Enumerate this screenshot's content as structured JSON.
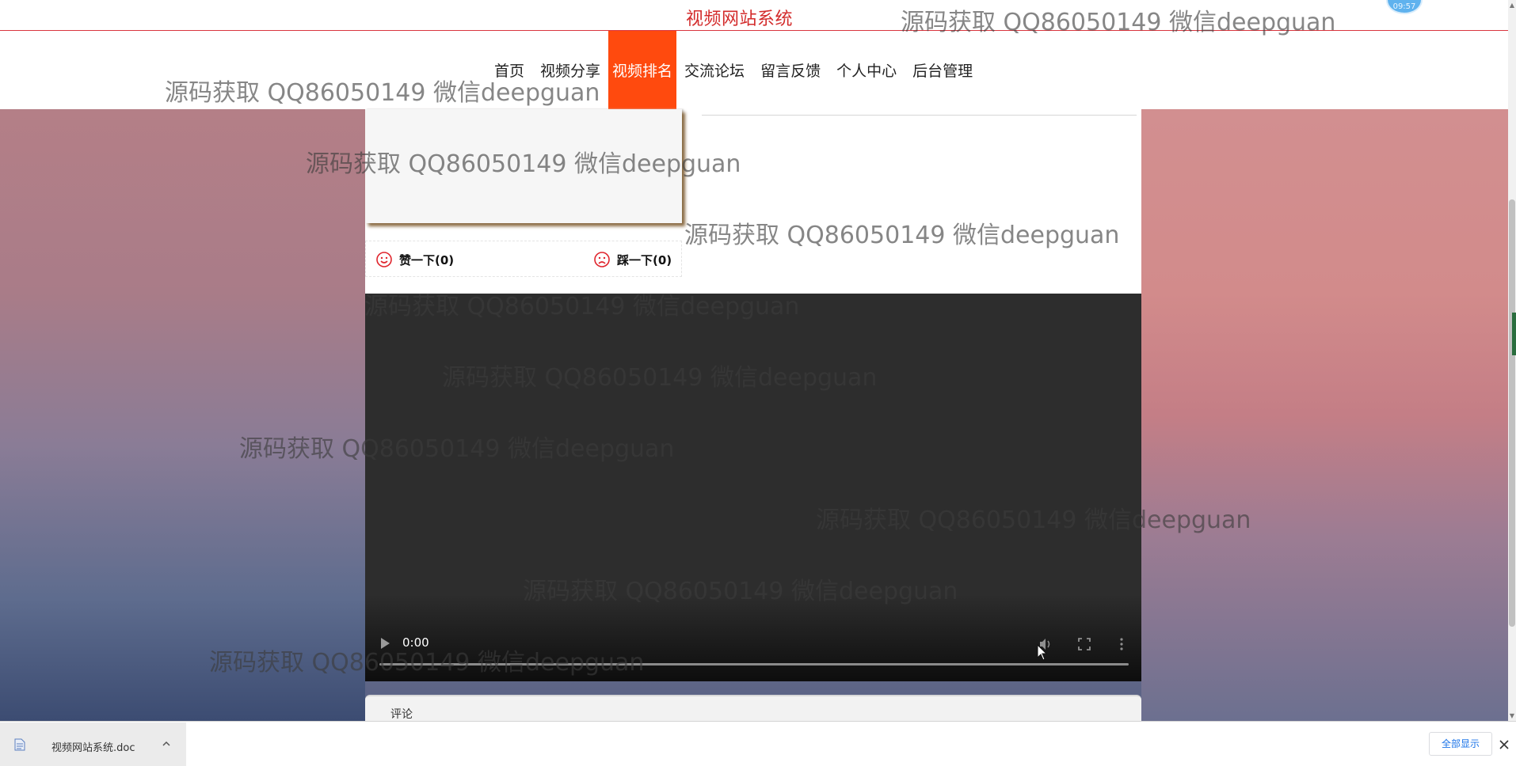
{
  "header": {
    "site_title": "视频网站系统",
    "avatar_time": "09:57"
  },
  "nav": {
    "items": [
      {
        "label": "首页",
        "active": false
      },
      {
        "label": "视频分享",
        "active": false
      },
      {
        "label": "视频排名",
        "active": true
      },
      {
        "label": "交流论坛",
        "active": false
      },
      {
        "label": "留言反馈",
        "active": false
      },
      {
        "label": "个人中心",
        "active": false
      },
      {
        "label": "后台管理",
        "active": false
      }
    ],
    "active_color": "#ff4a0e"
  },
  "votes": {
    "like_label": "赞一下(0)",
    "dislike_label": "踩一下(0)",
    "icon_color": "#e0262e"
  },
  "video": {
    "time": "0:00"
  },
  "comments": {
    "label": "评论"
  },
  "watermark_text": "源码获取 QQ86050149 微信deepguan",
  "download_bar": {
    "file_name": "视频网站系统.doc",
    "show_all_label": "全部显示"
  }
}
